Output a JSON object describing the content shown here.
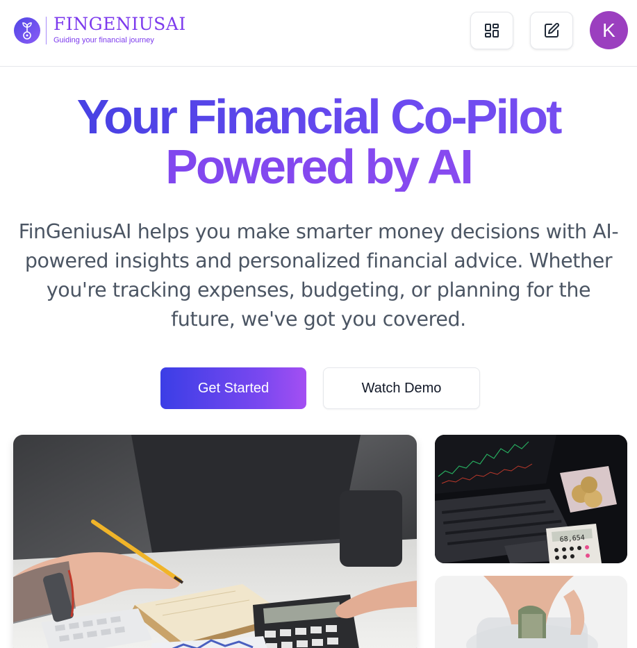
{
  "brand": {
    "name": "FINGENIUSAI",
    "tagline": "Guiding your financial journey",
    "icon": "sprout-coin-icon"
  },
  "header": {
    "grid_icon": "grid-icon",
    "edit_icon": "edit-icon",
    "avatar_initial": "K"
  },
  "hero": {
    "title_line1": "Your Financial Co-Pilot",
    "title_line2": "Powered by AI",
    "subtitle_line1": "FinGeniusAI helps you make smarter money decisions with AI-",
    "subtitle_line2": "powered insights and personalized financial advice. Whether",
    "subtitle_line3": "you're tracking expenses, budgeting, or planning for the",
    "subtitle_line4": "future, we've got you covered."
  },
  "actions": {
    "primary_label": "Get Started",
    "secondary_label": "Watch Demo"
  },
  "gallery": {
    "calculator_readout": "68,654"
  },
  "colors": {
    "brand": "#7c3aed",
    "primary_gradient_start": "#3b3ee6",
    "primary_gradient_end": "#a44ff2",
    "avatar": "#9b3fbf"
  }
}
